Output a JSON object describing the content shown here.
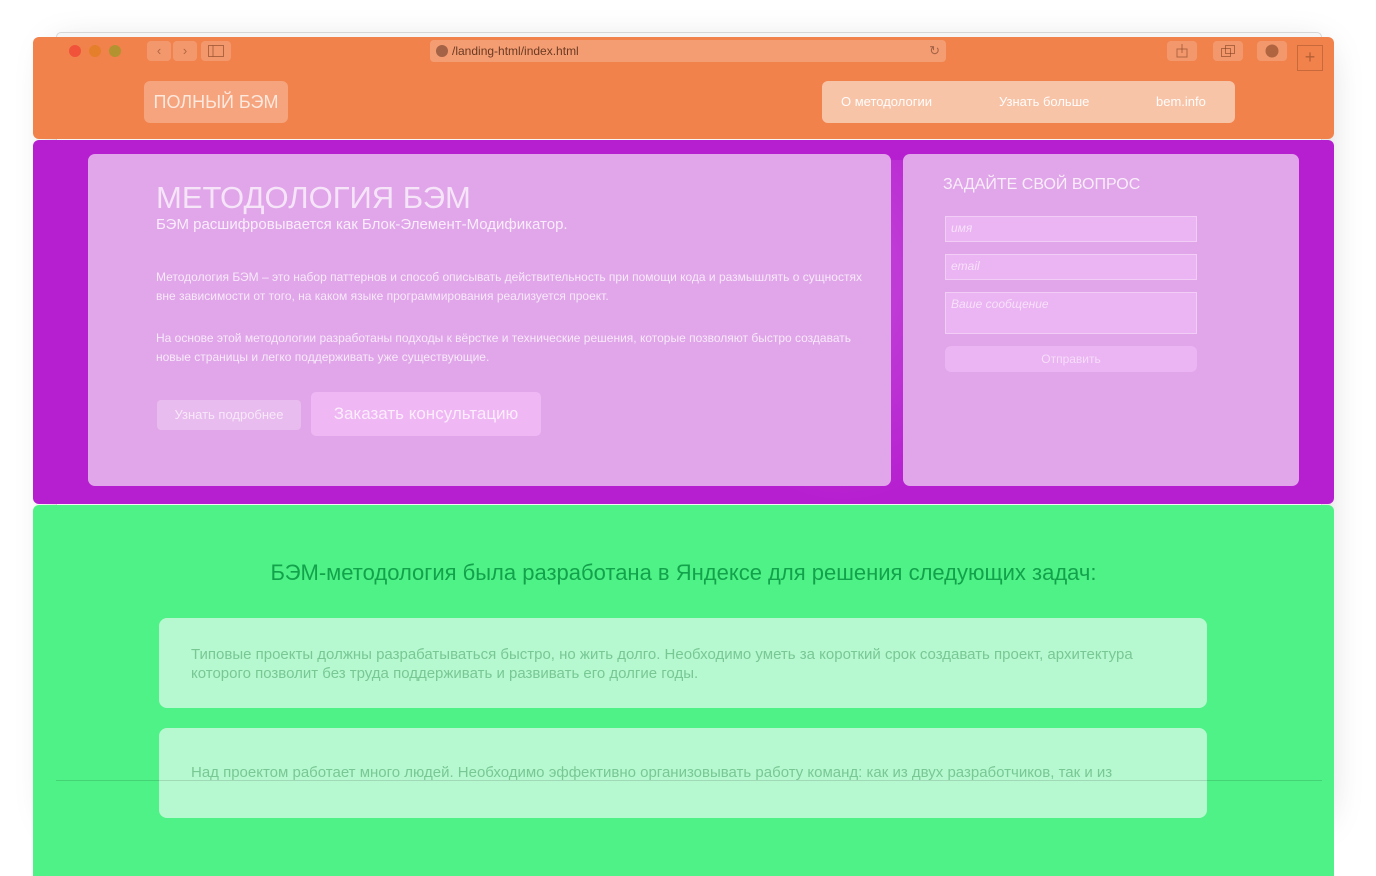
{
  "browser": {
    "address": "/landing-html/index.html",
    "back_icon": "‹",
    "forward_icon": "›",
    "reload_icon": "↻",
    "plus_label": "+"
  },
  "header": {
    "logo": "ПОЛНЫЙ БЭМ",
    "nav": [
      "О методологии",
      "Узнать больше",
      "bem.info"
    ]
  },
  "hero": {
    "title": "МЕТОДОЛОГИЯ БЭМ",
    "subtitle": "БЭМ расшифровывается как Блок-Элемент-Модификатор.",
    "paragraphs": [
      "Методология БЭМ – это набор паттернов и способ описывать действительность при помощи кода и размышлять о сущностях вне зависимости от того, на каком языке программирования реализуется проект.",
      "На основе этой методологии разработаны подходы к вёрстке и технические решения, которые позволяют быстро создавать новые страницы и легко поддерживать уже существующие."
    ],
    "btn_more": "Узнать подробнее",
    "btn_consult": "Заказать консультацию"
  },
  "form": {
    "title": "ЗАДАЙТЕ СВОЙ ВОПРОС",
    "name_placeholder": "имя",
    "email_placeholder": "email",
    "message_placeholder": "Ваше сообщение",
    "submit": "Отправить"
  },
  "tasks": {
    "heading": "БЭМ-методология была разработана в Яндексе для решения следующих задач:",
    "items": [
      "Типовые проекты должны разрабатываться быстро, но жить долго. Необходимо уметь за короткий срок создавать проект, архитектура которого позволит без труда поддерживать и развивать его долгие годы.",
      "Над проектом работает много людей. Необходимо эффективно организовывать работу команд: как из двух разработчиков, так и из"
    ]
  },
  "colors": {
    "orange_overlay": "#f1824c",
    "magenta_overlay": "#b61fd0",
    "green_overlay": "#4ef286"
  }
}
